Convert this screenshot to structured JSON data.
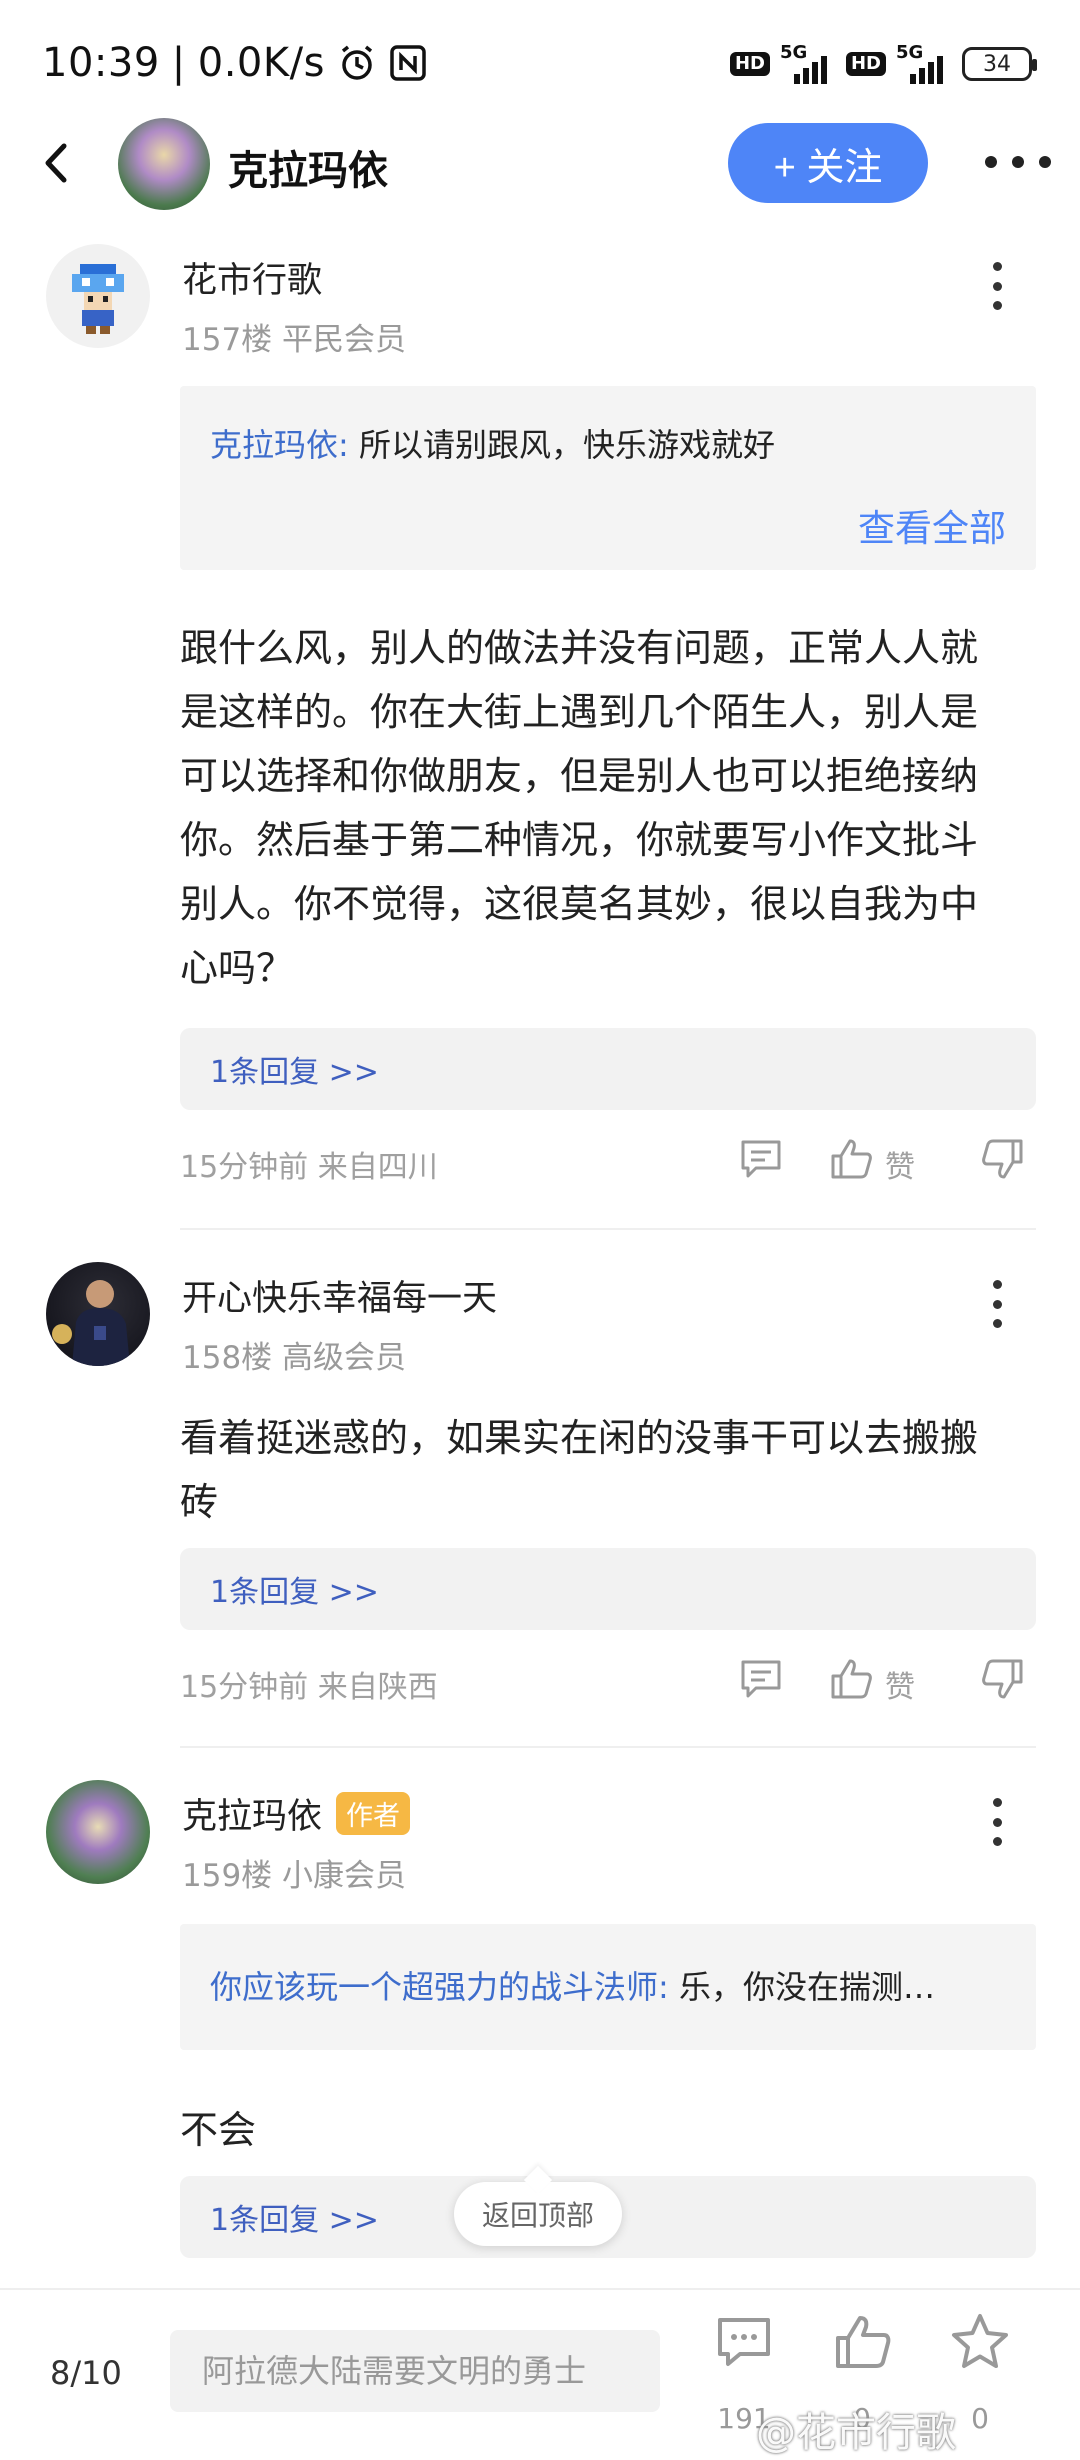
{
  "status_bar": {
    "time": "10:39",
    "separator": "|",
    "net_speed": "0.0K/s",
    "hd1": "HD",
    "sig1": "5G",
    "hd2": "HD",
    "sig2": "5G",
    "battery": "34"
  },
  "header": {
    "title": "克拉玛依",
    "follow_label": "+ 关注"
  },
  "posts": [
    {
      "username": "花市行歌",
      "floor_meta": "157楼  平民会员",
      "quote_name": "克拉玛依:",
      "quote_text": " 所以请别跟风，快乐游戏就好",
      "view_all": "查看全部",
      "body_lines": [
        "跟什么风，别人的做法并没有问题，正常人人就",
        "是这样的。你在大街上遇到几个陌生人，别人是",
        "可以选择和你做朋友，但是别人也可以拒绝接纳",
        "你。然后基于第二种情况，你就要写小作文批斗",
        "别人。你不觉得，这很莫名其妙，很以自我为中",
        "心吗？"
      ],
      "reply_label": "1条回复 >>",
      "time_loc": "15分钟前  来自四川",
      "like_label": "赞"
    },
    {
      "username": "开心快乐幸福每一天",
      "floor_meta": "158楼  高级会员",
      "body_lines": [
        "看着挺迷惑的，如果实在闲的没事干可以去搬搬",
        "砖"
      ],
      "reply_label": "1条回复 >>",
      "time_loc": "15分钟前  来自陕西",
      "like_label": "赞"
    },
    {
      "username": "克拉玛依",
      "author_badge": "作者",
      "floor_meta": "159楼  小康会员",
      "quote_name": "你应该玩一个超强力的战斗法师:",
      "quote_text": " 乐，你没在揣测…",
      "body_lines": [
        "不会"
      ],
      "reply_label": "1条回复 >>"
    }
  ],
  "back_to_top": "返回顶部",
  "bottom_bar": {
    "page": "8/10",
    "input_placeholder": "阿拉德大陆需要文明的勇士",
    "comment_count": "191",
    "like_count": "0",
    "star_count": "0"
  },
  "watermark": "@花市行歌",
  "colors": {
    "accent": "#4e85f7",
    "link": "#3e6dcc",
    "author_badge": "#f6b844"
  },
  "icons": [
    "back-arrow-icon",
    "alarm-icon",
    "nfc-icon",
    "more-horizontal-icon",
    "more-vertical-icon",
    "comment-icon",
    "thumbs-up-icon",
    "thumbs-down-icon",
    "star-icon"
  ]
}
